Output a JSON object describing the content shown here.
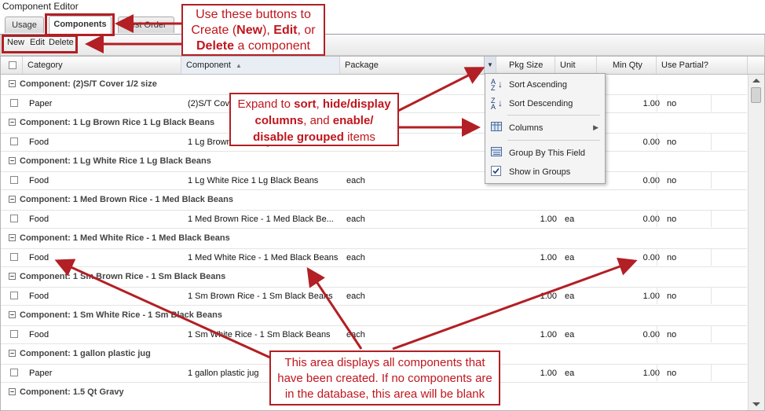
{
  "window": {
    "title": "Component Editor"
  },
  "tabs": [
    {
      "label": "Usage",
      "active": false
    },
    {
      "label": "Components",
      "active": true
    },
    {
      "label": "Test Order",
      "active": false
    }
  ],
  "toolbar": {
    "new_label": "New",
    "edit_label": "Edit",
    "delete_label": "Delete"
  },
  "columns": {
    "category": "Category",
    "component": "Component",
    "package": "Package",
    "pkg_size": "Pkg Size",
    "unit": "Unit",
    "min_qty": "Min Qty",
    "use_partial": "Use Partial?"
  },
  "groups": [
    {
      "title": "Component: (2)S/T Cover 1/2 size",
      "row": {
        "category": "Paper",
        "component": "(2)S/T Cover 1/2 size",
        "package": "",
        "pkg_size": "",
        "unit": "",
        "min_qty": "1.00",
        "use_partial": "no"
      }
    },
    {
      "title": "Component: 1 Lg Brown Rice 1 Lg Black Beans",
      "row": {
        "category": "Food",
        "component": "1 Lg Brown Rice 1 Lg Black Beans",
        "package": "",
        "pkg_size": "",
        "unit": "",
        "min_qty": "0.00",
        "use_partial": "no"
      }
    },
    {
      "title": "Component: 1 Lg White Rice 1 Lg Black Beans",
      "row": {
        "category": "Food",
        "component": "1 Lg White Rice 1 Lg Black Beans",
        "package": "each",
        "pkg_size": "",
        "unit": "",
        "min_qty": "0.00",
        "use_partial": "no"
      }
    },
    {
      "title": "Component: 1 Med Brown Rice - 1 Med Black Beans",
      "row": {
        "category": "Food",
        "component": "1 Med Brown Rice - 1 Med Black Be...",
        "package": "each",
        "pkg_size": "1.00",
        "unit": "ea",
        "min_qty": "0.00",
        "use_partial": "no"
      }
    },
    {
      "title": "Component: 1 Med White Rice - 1 Med Black Beans",
      "row": {
        "category": "Food",
        "component": "1 Med White Rice - 1 Med Black Beans",
        "package": "each",
        "pkg_size": "1.00",
        "unit": "ea",
        "min_qty": "0.00",
        "use_partial": "no"
      }
    },
    {
      "title": "Component: 1 Sm Brown Rice - 1 Sm Black Beans",
      "row": {
        "category": "Food",
        "component": "1 Sm Brown Rice - 1 Sm Black Beans",
        "package": "each",
        "pkg_size": "1.00",
        "unit": "ea",
        "min_qty": "1.00",
        "use_partial": "no"
      }
    },
    {
      "title": "Component: 1 Sm White Rice - 1 Sm Black Beans",
      "row": {
        "category": "Food",
        "component": "1 Sm White Rice - 1 Sm Black Beans",
        "package": "each",
        "pkg_size": "1.00",
        "unit": "ea",
        "min_qty": "0.00",
        "use_partial": "no"
      }
    },
    {
      "title": "Component: 1 gallon plastic jug",
      "row": {
        "category": "Paper",
        "component": "1 gallon plastic jug",
        "package": "each",
        "pkg_size": "1.00",
        "unit": "ea",
        "min_qty": "1.00",
        "use_partial": "no"
      }
    },
    {
      "title": "Component: 1.5 Qt Gravy",
      "row": null
    }
  ],
  "column_menu": [
    {
      "label": "Sort Ascending",
      "icon": "sort-ascending-icon"
    },
    {
      "label": "Sort Descending",
      "icon": "sort-descending-icon"
    },
    {
      "label": "Columns",
      "icon": "columns-icon"
    },
    {
      "label": "Group By This Field",
      "icon": "group-by-icon"
    },
    {
      "label": "Show in Groups",
      "icon": "checkbox-checked-icon"
    }
  ],
  "callouts": {
    "buttons": {
      "l1": "Use these buttons to",
      "l2a": "Create (",
      "new": "New",
      "l2b": "), ",
      "edit": "Edit",
      "l2c": ", or",
      "delete": "Delete",
      "l3": " a component"
    },
    "expand": {
      "l1a": "Expand to ",
      "sort": "sort",
      "l1b": ", ",
      "hide": "hide/display",
      "cols": "columns",
      "l2b": ", and ",
      "enable": "enable/",
      "disable": "disable grouped",
      "items": " items"
    },
    "area": {
      "l1": "This area displays all components that",
      "l2": "have been created. If no components are",
      "l3": "in the database, this area will be blank"
    }
  },
  "colors": {
    "callout_red": "#b21f24"
  }
}
